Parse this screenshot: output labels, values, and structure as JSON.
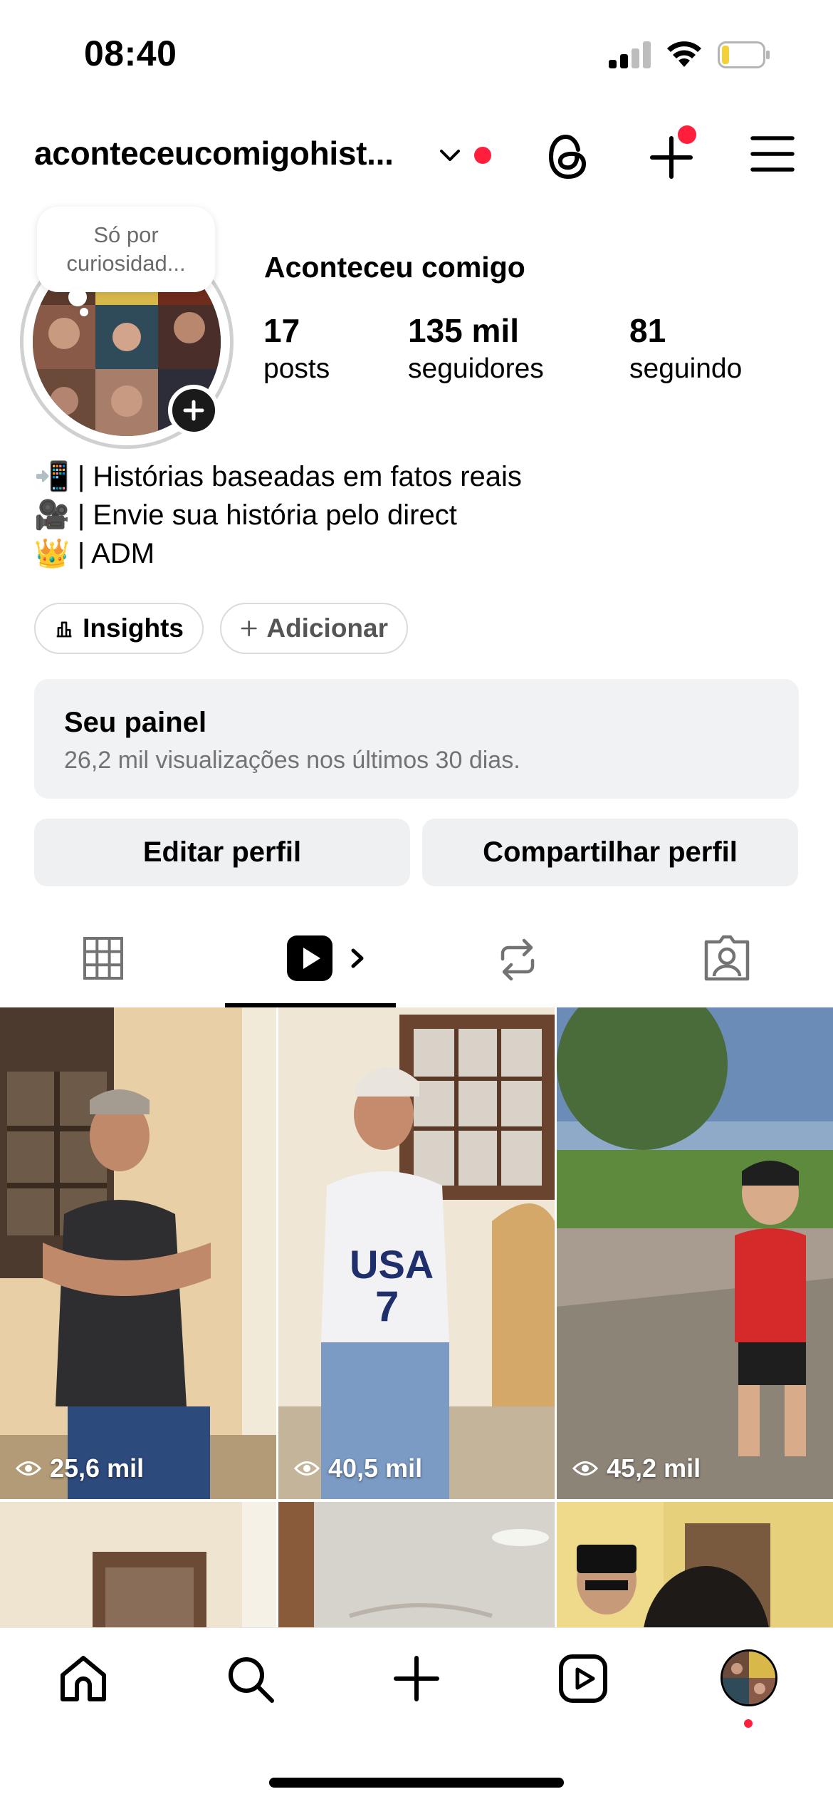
{
  "status_bar": {
    "time": "08:40"
  },
  "header": {
    "username": "aconteceucomigohist...",
    "colors": {
      "notification_dot": "#ff1f3d"
    }
  },
  "profile": {
    "note": "Só por curiosidad...",
    "display_name": "Aconteceu comigo",
    "stats": [
      {
        "value": "17",
        "label": "posts"
      },
      {
        "value": "135 mil",
        "label": "seguidores"
      },
      {
        "value": "81",
        "label": "seguindo"
      }
    ],
    "bio": [
      {
        "emoji": "📲",
        "text": " | Histórias baseadas em fatos reais"
      },
      {
        "emoji": "🎥",
        "text": " | Envie sua história pelo direct"
      },
      {
        "emoji": "👑",
        "text": " | ADM"
      }
    ],
    "chips": {
      "insights": "Insights",
      "add": "Adicionar"
    }
  },
  "dashboard": {
    "title": "Seu painel",
    "subtitle": "26,2 mil visualizações nos últimos 30 dias."
  },
  "buttons": {
    "edit": "Editar perfil",
    "share": "Compartilhar perfil"
  },
  "tabs": [
    {
      "icon": "grid-icon"
    },
    {
      "icon": "reels-icon",
      "active": true
    },
    {
      "icon": "repost-icon"
    },
    {
      "icon": "tagged-icon"
    }
  ],
  "reels": [
    {
      "views": "25,6 mil"
    },
    {
      "views": "40,5 mil"
    },
    {
      "views": "45,2 mil"
    },
    {
      "views": ""
    },
    {
      "views": ""
    },
    {
      "views": ""
    }
  ],
  "bottom_nav": [
    {
      "icon": "home-icon"
    },
    {
      "icon": "search-icon"
    },
    {
      "icon": "create-icon"
    },
    {
      "icon": "reels-nav-icon"
    },
    {
      "icon": "profile-avatar"
    }
  ]
}
